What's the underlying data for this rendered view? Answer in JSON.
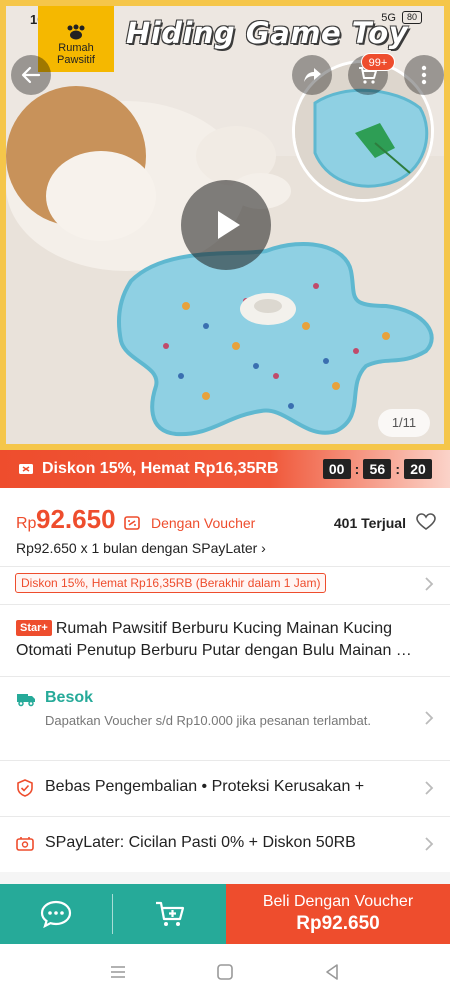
{
  "status_bar": {
    "time": "10.05",
    "network": "5G",
    "battery": "80"
  },
  "hero": {
    "brand_logo": "Rumah Pawsitif",
    "title": "Hiding Game Toy",
    "cart_badge": "99+",
    "image_counter": "1/11",
    "icons": [
      "back-arrow-icon",
      "share-icon",
      "cart-icon",
      "more-icon",
      "play-icon"
    ]
  },
  "flash_sale": {
    "text": "Diskon 15%, Hemat Rp16,35RB",
    "countdown": [
      "00",
      "56",
      "20"
    ]
  },
  "price": {
    "currency": "Rp",
    "value": "92.650",
    "voucher_label": "Dengan Voucher",
    "sold": "401 Terjual",
    "spaylater": "Rp92.650 x 1 bulan dengan SPayLater ›"
  },
  "discount": {
    "chip": "Diskon 15%, Hemat Rp16,35RB (Berakhir dalam 1 Jam)"
  },
  "product": {
    "badge": "Star+",
    "title_line1": "Rumah Pawsitif Berburu Kucing Mainan Kucing",
    "title_line2": "Otomati Penutup Berburu Putar dengan Bulu Mainan …"
  },
  "shipping": {
    "title": "Besok",
    "desc": "Dapatkan Voucher s/d Rp10.000 jika pesanan terlambat."
  },
  "rows": {
    "returns": "Bebas Pengembalian  •  Proteksi Kerusakan +",
    "spaylater": "SPayLater: Cicilan Pasti 0% + Diskon 50RB"
  },
  "action_bar": {
    "buy_label": "Beli Dengan Voucher",
    "buy_price": "Rp92.650"
  },
  "colors": {
    "accent": "#ee4d2d",
    "teal": "#26aa99",
    "frame": "#f5c64a"
  }
}
